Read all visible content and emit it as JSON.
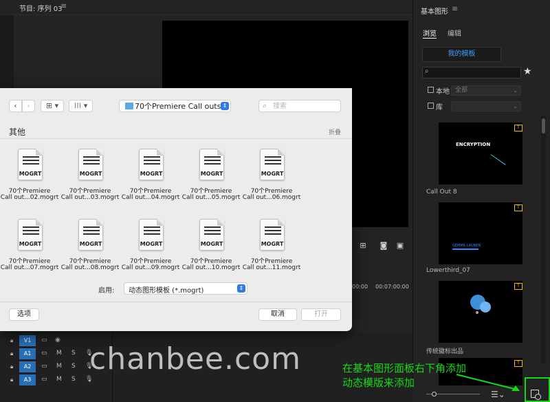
{
  "program": {
    "title": "节目: 序列 03",
    "menu_icon": "≡",
    "timecodes": [
      "00:00",
      "00:07:00:00"
    ]
  },
  "tracks": [
    {
      "name": "V1",
      "selected": false,
      "has_m": false
    },
    {
      "name": "A1",
      "selected": true,
      "m": "M",
      "s": "S"
    },
    {
      "name": "A2",
      "selected": true,
      "m": "M",
      "s": "S"
    },
    {
      "name": "A3",
      "selected": true,
      "m": "M",
      "s": "S"
    }
  ],
  "dialog": {
    "folder": "70个Premiere Call outs...",
    "search_placeholder": "搜索",
    "section_title": "其他",
    "collapse": "折叠",
    "doc_label": "MOGRT",
    "files": [
      {
        "line1": "70个Premiere",
        "line2": "Call out...02.mogrt"
      },
      {
        "line1": "70个Premiere",
        "line2": "Call out...03.mogrt"
      },
      {
        "line1": "70个Premiere",
        "line2": "Call out...04.mogrt"
      },
      {
        "line1": "70个Premiere",
        "line2": "Call out...05.mogrt"
      },
      {
        "line1": "70个Premiere",
        "line2": "Call out...06.mogrt"
      },
      {
        "line1": "70个Premiere",
        "line2": "Call out...07.mogrt"
      },
      {
        "line1": "70个Premiere",
        "line2": "Call out...08.mogrt"
      },
      {
        "line1": "70个Premiere",
        "line2": "Call out...09.mogrt"
      },
      {
        "line1": "70个Premiere",
        "line2": "Call out...10.mogrt"
      },
      {
        "line1": "70个Premiere",
        "line2": "Call out...11.mogrt"
      }
    ],
    "enable_label": "启用:",
    "format": "动态图形模板 (*.mogrt)",
    "options": "选项",
    "cancel": "取消",
    "open": "打开"
  },
  "panel": {
    "title": "基本图形",
    "menu_icon": "≡",
    "tabs": [
      "浏览",
      "编辑"
    ],
    "my_templates": "我的模板",
    "local_label": "本地",
    "local_value": "全部",
    "library_label": "库",
    "items": [
      {
        "name": "Call Out 8",
        "caption": "ENCRYPTION"
      },
      {
        "name": "Lowerthird_07",
        "caption": "GEMMA LAUNEN"
      },
      {
        "name": "传统徽标出品",
        "caption": ""
      }
    ]
  },
  "annotation": {
    "line1": "在基本图形面板右下角添加",
    "line2": "动态模版来添加"
  },
  "watermark": "chanbee.com",
  "colors": {
    "accent_blue": "#2f7ae5",
    "track_blue": "#2a6fb5",
    "highlight_green": "#16d916",
    "badge_yellow": "#f1c100"
  }
}
